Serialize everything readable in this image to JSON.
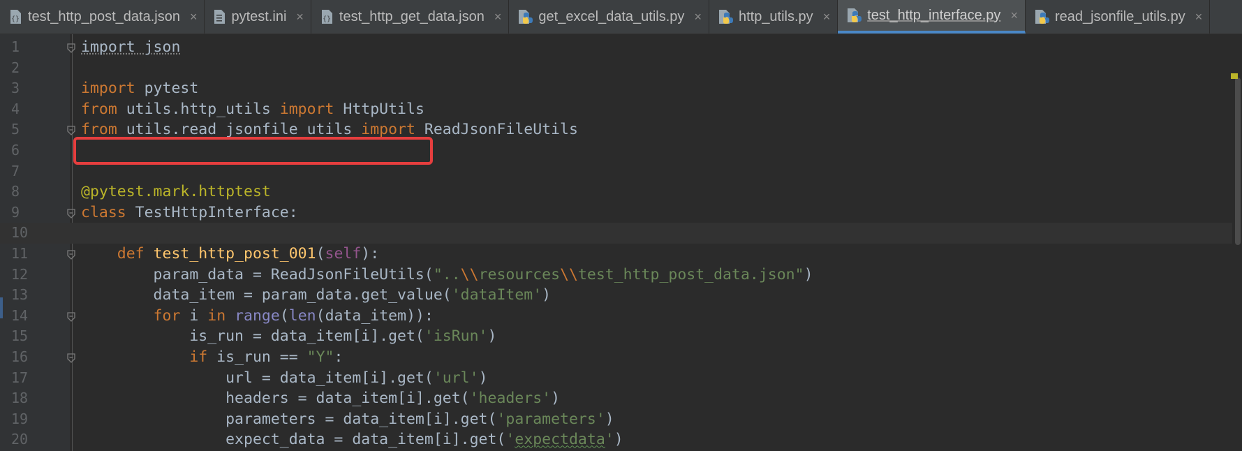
{
  "tabs": [
    {
      "label": "test_http_post_data.json",
      "icon": "json-file-icon",
      "active": false
    },
    {
      "label": "pytest.ini",
      "icon": "ini-file-icon",
      "active": false
    },
    {
      "label": "test_http_get_data.json",
      "icon": "json-file-icon",
      "active": false
    },
    {
      "label": "get_excel_data_utils.py",
      "icon": "python-file-icon",
      "active": false
    },
    {
      "label": "http_utils.py",
      "icon": "python-file-icon",
      "active": false
    },
    {
      "label": "test_http_interface.py",
      "icon": "python-file-icon",
      "active": true
    },
    {
      "label": "read_jsonfile_utils.py",
      "icon": "python-file-icon",
      "active": false
    }
  ],
  "tab_close_glyph": "×",
  "colors": {
    "background": "#2b2b2b",
    "keyword": "#cc7832",
    "string": "#6a8759",
    "decorator": "#bbb529",
    "function": "#ffc66d",
    "highlight_box": "#e53e3e"
  },
  "code_lines": [
    {
      "n": "1",
      "fold": true,
      "parts": [
        {
          "t": "import json",
          "c": "sq-gray"
        }
      ]
    },
    {
      "n": "2",
      "fold": false,
      "parts": []
    },
    {
      "n": "3",
      "fold": false,
      "parts": [
        {
          "t": "import",
          "c": "kw"
        },
        {
          "t": " pytest",
          "c": ""
        }
      ]
    },
    {
      "n": "4",
      "fold": false,
      "parts": [
        {
          "t": "from",
          "c": "kw"
        },
        {
          "t": " utils.http_utils ",
          "c": ""
        },
        {
          "t": "import",
          "c": "kw"
        },
        {
          "t": " HttpUtils",
          "c": ""
        }
      ]
    },
    {
      "n": "5",
      "fold": true,
      "parts": [
        {
          "t": "from",
          "c": "kw"
        },
        {
          "t": " utils.read_jsonfile_utils ",
          "c": ""
        },
        {
          "t": "import",
          "c": "kw"
        },
        {
          "t": " ReadJsonFileUtils",
          "c": ""
        }
      ]
    },
    {
      "n": "6",
      "fold": false,
      "parts": []
    },
    {
      "n": "7",
      "fold": false,
      "parts": []
    },
    {
      "n": "8",
      "fold": false,
      "parts": [
        {
          "t": "@pytest.mark.httptest",
          "c": "dec"
        }
      ]
    },
    {
      "n": "9",
      "fold": true,
      "parts": [
        {
          "t": "class",
          "c": "kw"
        },
        {
          "t": " TestHttpInterface:",
          "c": ""
        }
      ]
    },
    {
      "n": "10",
      "fold": false,
      "current": true,
      "parts": []
    },
    {
      "n": "11",
      "fold": true,
      "parts": [
        {
          "t": "    def",
          "c": "kw"
        },
        {
          "t": " ",
          "c": ""
        },
        {
          "t": "test_http_post_001",
          "c": "fn"
        },
        {
          "t": "(",
          "c": ""
        },
        {
          "t": "self",
          "c": "self"
        },
        {
          "t": "):",
          "c": ""
        }
      ]
    },
    {
      "n": "12",
      "fold": false,
      "parts": [
        {
          "t": "        param_data = ReadJsonFileUtils(",
          "c": ""
        },
        {
          "t": "\"..",
          "c": "str"
        },
        {
          "t": "\\\\",
          "c": "kw"
        },
        {
          "t": "resources",
          "c": "str"
        },
        {
          "t": "\\\\",
          "c": "kw"
        },
        {
          "t": "test_http_post_data.json\"",
          "c": "str"
        },
        {
          "t": ")",
          "c": ""
        }
      ]
    },
    {
      "n": "13",
      "fold": false,
      "parts": [
        {
          "t": "        data_item = param_data.get_value(",
          "c": ""
        },
        {
          "t": "'dataItem'",
          "c": "str"
        },
        {
          "t": ")",
          "c": ""
        }
      ]
    },
    {
      "n": "14",
      "fold": true,
      "parts": [
        {
          "t": "        ",
          "c": ""
        },
        {
          "t": "for",
          "c": "kw"
        },
        {
          "t": " i ",
          "c": ""
        },
        {
          "t": "in",
          "c": "kw"
        },
        {
          "t": " ",
          "c": ""
        },
        {
          "t": "range",
          "c": "builtin"
        },
        {
          "t": "(",
          "c": ""
        },
        {
          "t": "len",
          "c": "builtin"
        },
        {
          "t": "(data_item)):",
          "c": ""
        }
      ]
    },
    {
      "n": "15",
      "fold": false,
      "parts": [
        {
          "t": "            is_run = data_item[i].get(",
          "c": ""
        },
        {
          "t": "'isRun'",
          "c": "str"
        },
        {
          "t": ")",
          "c": ""
        }
      ]
    },
    {
      "n": "16",
      "fold": true,
      "parts": [
        {
          "t": "            ",
          "c": ""
        },
        {
          "t": "if",
          "c": "kw"
        },
        {
          "t": " is_run == ",
          "c": ""
        },
        {
          "t": "\"Y\"",
          "c": "str"
        },
        {
          "t": ":",
          "c": ""
        }
      ]
    },
    {
      "n": "17",
      "fold": false,
      "parts": [
        {
          "t": "                url = data_item[i].get(",
          "c": ""
        },
        {
          "t": "'url'",
          "c": "str"
        },
        {
          "t": ")",
          "c": ""
        }
      ]
    },
    {
      "n": "18",
      "fold": false,
      "parts": [
        {
          "t": "                headers = data_item[i].get(",
          "c": ""
        },
        {
          "t": "'headers'",
          "c": "str"
        },
        {
          "t": ")",
          "c": ""
        }
      ]
    },
    {
      "n": "19",
      "fold": false,
      "parts": [
        {
          "t": "                parameters = data_item[i].get(",
          "c": ""
        },
        {
          "t": "'parameters'",
          "c": "str"
        },
        {
          "t": ")",
          "c": ""
        }
      ]
    },
    {
      "n": "20",
      "fold": false,
      "parts": [
        {
          "t": "                expect_data = data_item[i].get(",
          "c": ""
        },
        {
          "t": "'",
          "c": "str"
        },
        {
          "t": "expectdata",
          "c": "str squig"
        },
        {
          "t": "'",
          "c": "str"
        },
        {
          "t": ")",
          "c": ""
        }
      ]
    }
  ]
}
